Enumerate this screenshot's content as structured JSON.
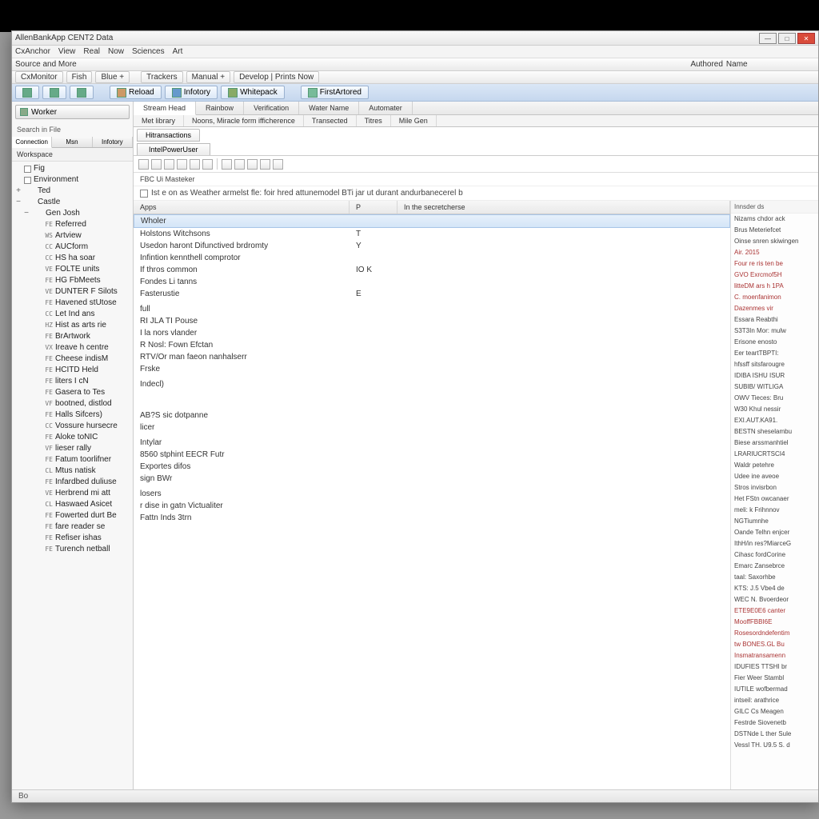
{
  "window": {
    "title": "AllenBankApp CENT2 Data"
  },
  "menubar": [
    "CxAnchor",
    "View",
    "Real",
    "Now",
    "Sciences",
    "Art"
  ],
  "subbar": {
    "left": "Source and More",
    "mid": [
      "Authored",
      "Name"
    ],
    "btns": [
      "CxMonitor",
      "Fish",
      "Blue +",
      "",
      "Trackers",
      "Manual +",
      "Develop | Prints Now"
    ]
  },
  "ribbon": [
    {
      "label": "Reload"
    },
    {
      "label": "Infotory"
    },
    {
      "label": "Whitepack"
    },
    {
      "label": "FirstArtored"
    }
  ],
  "left": {
    "btn": "Worker",
    "lbl": "Search in File",
    "tabs": [
      "Connection",
      "Msn",
      "Infotory"
    ],
    "treehead": "Workspace",
    "tree": [
      {
        "tw": "",
        "chk": true,
        "mk": "",
        "txt": "Fig",
        "ind": 0
      },
      {
        "tw": "",
        "chk": true,
        "mk": "",
        "txt": "Environment",
        "ind": 0
      },
      {
        "tw": "+",
        "chk": false,
        "mk": "",
        "txt": "Ted",
        "ind": 0
      },
      {
        "tw": "−",
        "chk": false,
        "mk": "",
        "txt": "Castle",
        "ind": 0
      },
      {
        "tw": "−",
        "chk": false,
        "mk": "",
        "txt": "Gen Josh",
        "ind": 1
      },
      {
        "tw": "",
        "chk": false,
        "mk": "FE",
        "txt": "Referred",
        "ind": 2
      },
      {
        "tw": "",
        "chk": false,
        "mk": "WS",
        "txt": "Artview",
        "ind": 2
      },
      {
        "tw": "",
        "chk": false,
        "mk": "CC",
        "txt": "AUCform",
        "ind": 2
      },
      {
        "tw": "",
        "chk": false,
        "mk": "CC",
        "txt": "HS ha soar",
        "ind": 2
      },
      {
        "tw": "",
        "chk": false,
        "mk": "VE",
        "txt": "FOLTE units",
        "ind": 2
      },
      {
        "tw": "",
        "chk": false,
        "mk": "FE",
        "txt": "HG FbMeets",
        "ind": 2
      },
      {
        "tw": "",
        "chk": false,
        "mk": "VE",
        "txt": "DUNTER F Silots",
        "ind": 2
      },
      {
        "tw": "",
        "chk": false,
        "mk": "FE",
        "txt": "Havened stUtose",
        "ind": 2
      },
      {
        "tw": "",
        "chk": false,
        "mk": "CC",
        "txt": "Let Ind ans",
        "ind": 2
      },
      {
        "tw": "",
        "chk": false,
        "mk": "HZ",
        "txt": "Hist as arts rie",
        "ind": 2
      },
      {
        "tw": "",
        "chk": false,
        "mk": "FE",
        "txt": "BrArtwork",
        "ind": 2
      },
      {
        "tw": "",
        "chk": false,
        "mk": "VX",
        "txt": "Ireave h centre",
        "ind": 2
      },
      {
        "tw": "",
        "chk": false,
        "mk": "FE",
        "txt": "Cheese indisM",
        "ind": 2
      },
      {
        "tw": "",
        "chk": false,
        "mk": "FE",
        "txt": "HCITD Held",
        "ind": 2
      },
      {
        "tw": "",
        "chk": false,
        "mk": "FE",
        "txt": "liters I cN",
        "ind": 2
      },
      {
        "tw": "",
        "chk": false,
        "mk": "FE",
        "txt": "Gasera to Tes",
        "ind": 2
      },
      {
        "tw": "",
        "chk": false,
        "mk": "VF",
        "txt": "bootned, distlod",
        "ind": 2
      },
      {
        "tw": "",
        "chk": false,
        "mk": "FE",
        "txt": "Halls Sifcers)",
        "ind": 2
      },
      {
        "tw": "",
        "chk": false,
        "mk": "CC",
        "txt": "Vossure hursecre",
        "ind": 2
      },
      {
        "tw": "",
        "chk": false,
        "mk": "FE",
        "txt": "Aloke toNIC",
        "ind": 2
      },
      {
        "tw": "",
        "chk": false,
        "mk": "VF",
        "txt": "lieser rally",
        "ind": 2
      },
      {
        "tw": "",
        "chk": false,
        "mk": "FE",
        "txt": "Fatum toorlifner",
        "ind": 2
      },
      {
        "tw": "",
        "chk": false,
        "mk": "CL",
        "txt": "Mtus natisk",
        "ind": 2
      },
      {
        "tw": "",
        "chk": false,
        "mk": "FE",
        "txt": "Infardbed duliuse",
        "ind": 2
      },
      {
        "tw": "",
        "chk": false,
        "mk": "VE",
        "txt": "Herbrend mi att",
        "ind": 2
      },
      {
        "tw": "",
        "chk": false,
        "mk": "CL",
        "txt": "Haswaed Asicet",
        "ind": 2
      },
      {
        "tw": "",
        "chk": false,
        "mk": "FE",
        "txt": "Fowerted durt Be",
        "ind": 2
      },
      {
        "tw": "",
        "chk": false,
        "mk": "FE",
        "txt": "fare reader se",
        "ind": 2
      },
      {
        "tw": "",
        "chk": false,
        "mk": "FE",
        "txt": "Refiser ishas",
        "ind": 2
      },
      {
        "tw": "",
        "chk": false,
        "mk": "FE",
        "txt": "Turench netball",
        "ind": 2
      }
    ]
  },
  "main": {
    "tabs1": [
      "Stream Head",
      "Rainbow",
      "Verification",
      "Water Name",
      "Automater"
    ],
    "tabs2": [
      "Met library",
      "Noons, Miracle form ifficherence",
      "Transected",
      "Titres",
      "Mile Gen"
    ],
    "doctab": "Hitransactions",
    "subtab": "IntelPowerUser",
    "crumb": "FBC Ui Masteker",
    "chktext": "Ist e on as Weather armelst fle: foir hred attunemodel BTi jar ut durant andurbanecerel b",
    "cols": [
      "Apps",
      "P",
      "In the secretcherse"
    ],
    "rows": [
      {
        "a": "Wholer",
        "b": "",
        "hl": true
      },
      {
        "a": "Holstons Witchsons",
        "b": "T"
      },
      {
        "a": "Usedon haront Difunctived brdromty",
        "b": "Y"
      },
      {
        "a": "Infintion kennthell comprotor",
        "b": ""
      },
      {
        "a": "If thros common",
        "b": "IO K"
      },
      {
        "a": "Fondes Li tanns",
        "b": ""
      },
      {
        "a": "Fasterustie",
        "b": "E"
      },
      {
        "a": "",
        "b": ""
      },
      {
        "a": "full",
        "b": ""
      },
      {
        "a": "RI JLA TI Pouse",
        "b": ""
      },
      {
        "a": "I la nors vlander",
        "b": ""
      },
      {
        "a": "R Nosl: Fown Efctan",
        "b": ""
      },
      {
        "a": "RTV/Or man faeon nanhalserr",
        "b": ""
      },
      {
        "a": "Frske",
        "b": ""
      },
      {
        "a": "",
        "b": ""
      },
      {
        "a": "Indecl)",
        "b": ""
      },
      {
        "a": "",
        "b": ""
      },
      {
        "a": "",
        "b": ""
      },
      {
        "a": "",
        "b": ""
      },
      {
        "a": "",
        "b": ""
      },
      {
        "a": "",
        "b": ""
      },
      {
        "a": "",
        "b": ""
      },
      {
        "a": "AB?S sic dotpanne",
        "b": ""
      },
      {
        "a": "licer",
        "b": ""
      },
      {
        "a": "",
        "b": ""
      },
      {
        "a": "Intylar",
        "b": ""
      },
      {
        "a": "8560 stphint EECR Futr",
        "b": ""
      },
      {
        "a": "Exportes difos",
        "b": ""
      },
      {
        "a": "sign BWr",
        "b": ""
      },
      {
        "a": "",
        "b": ""
      },
      {
        "a": "losers",
        "b": ""
      },
      {
        "a": "r dise in gatn Victualiter",
        "b": ""
      },
      {
        "a": "Fattn Inds 3trn",
        "b": ""
      }
    ]
  },
  "right": {
    "header": "Innsder ds",
    "items": [
      "Nizams chdor ack",
      "Brus Meteriefcet",
      "Oinse snren skiwingen",
      "Air.   2015",
      "Four re ris ten be",
      "GVO Exrcmof5H",
      "litteDM ars h 1PA",
      "C. moenfanimon",
      "Dazenmes vir",
      "Essara Reabthi",
      "S3T3In Mor: mulw",
      "Erisone enosto",
      "Eer teartTBPTI:",
      "hfssff sitsfarougre",
      "IDIBA ISHU ISUR",
      "SUBIB/ WITLIGA",
      "OWV Tieces: Bru",
      "W30 Khul nessir",
      "EXI.AUT.KA91.",
      "BESTN sheselambu",
      "Biese arssmanhtiel",
      "LRARIUCRTSCI4",
      "Waldr petehre",
      "Udee ine aveoe",
      "Stros invisrbon",
      "Het FStn owcanaer",
      "meli: k Frihnnov",
      "NGTiumnhe",
      "Oande  Telhn enjcer",
      "IthH/in res?MiarceG",
      "Cihasc fordCorine",
      "Emarc Zansebrce",
      "taal: Saxorhbe",
      "KTS: J.5 Vbe4 de",
      "WEC N. Bvoerdeor",
      "ETE9E0E6 canter",
      "MooffFBBI6E",
      "Rosesordndefentim",
      "tw BONES.GL Bu",
      "Insmatransamenn",
      "IDUFIES TTSHI br",
      "Fier Weer Stambl",
      "IUTILE wofbermad",
      "intseil: arathrice",
      "GILC Cs Meagen",
      "Festrde Siovenetb",
      "DSTNde L ther Sule",
      "Vessl TH. U9.5 S. d"
    ]
  },
  "status": "Bo"
}
